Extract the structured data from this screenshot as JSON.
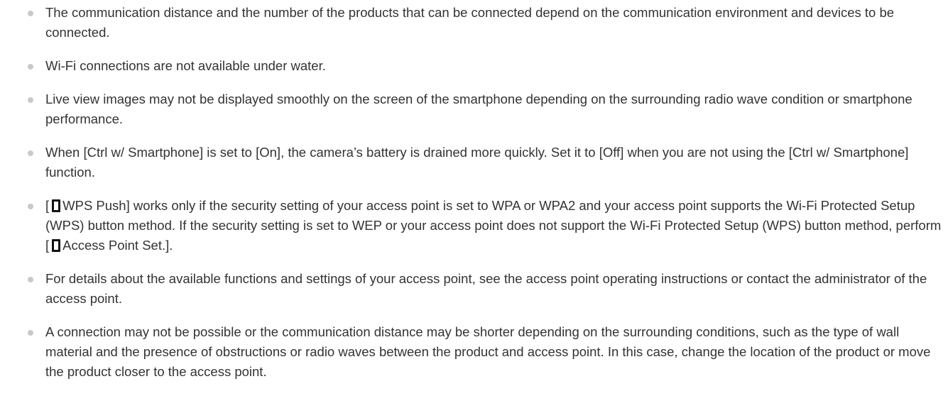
{
  "notes": [
    {
      "text": "The communication distance and the number of the products that can be connected depend on the communication environment and devices to be connected."
    },
    {
      "text": "Wi-Fi connections are not available under water."
    },
    {
      "text": "Live view images may not be displayed smoothly on the screen of the smartphone depending on the surrounding radio wave condition or smartphone performance."
    },
    {
      "text": "When [Ctrl w/ Smartphone] is set to [On], the camera’s battery is drained more quickly. Set it to [Off] when you are not using the [Ctrl w/ Smartphone] function."
    },
    {
      "part1": "[",
      "part2": "WPS Push] works only if the security setting of your access point is set to WPA or WPA2 and your access point supports the Wi-Fi Protected Setup (WPS) button method. If the security setting is set to WEP or your access point does not support the Wi-Fi Protected Setup (WPS) button method, perform [",
      "part3": "Access Point Set.].",
      "icon": "network-setting-icon"
    },
    {
      "text": "For details about the available functions and settings of your access point, see the access point operating instructions or contact the administrator of the access point."
    },
    {
      "text": "A connection may not be possible or the communication distance may be shorter depending on the surrounding conditions, such as the type of wall material and the presence of obstructions or radio waves between the product and access point. In this case, change the location of the product or move the product closer to the access point."
    }
  ],
  "colors": {
    "text": "#333333",
    "bullet": "#c9c9c9",
    "icon": "#111111"
  }
}
